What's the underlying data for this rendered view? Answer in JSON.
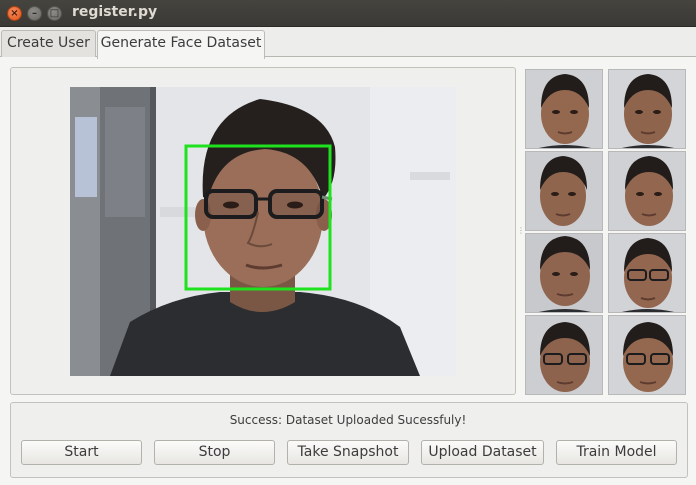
{
  "window": {
    "title": "register.py"
  },
  "tabs": [
    {
      "label": "Create User"
    },
    {
      "label": "Generate Face Dataset"
    }
  ],
  "status": {
    "text": "Success: Dataset Uploaded Sucessfuly!"
  },
  "buttons": {
    "start": "Start",
    "stop": "Stop",
    "snapshot": "Take Snapshot",
    "upload": "Upload Dataset",
    "train": "Train Model"
  },
  "colors": {
    "face_box": "#1ee21e",
    "close_button": "#e0541c"
  },
  "icons": {
    "close": "close-icon",
    "minimize": "minimize-icon",
    "maximize": "maximize-icon"
  }
}
